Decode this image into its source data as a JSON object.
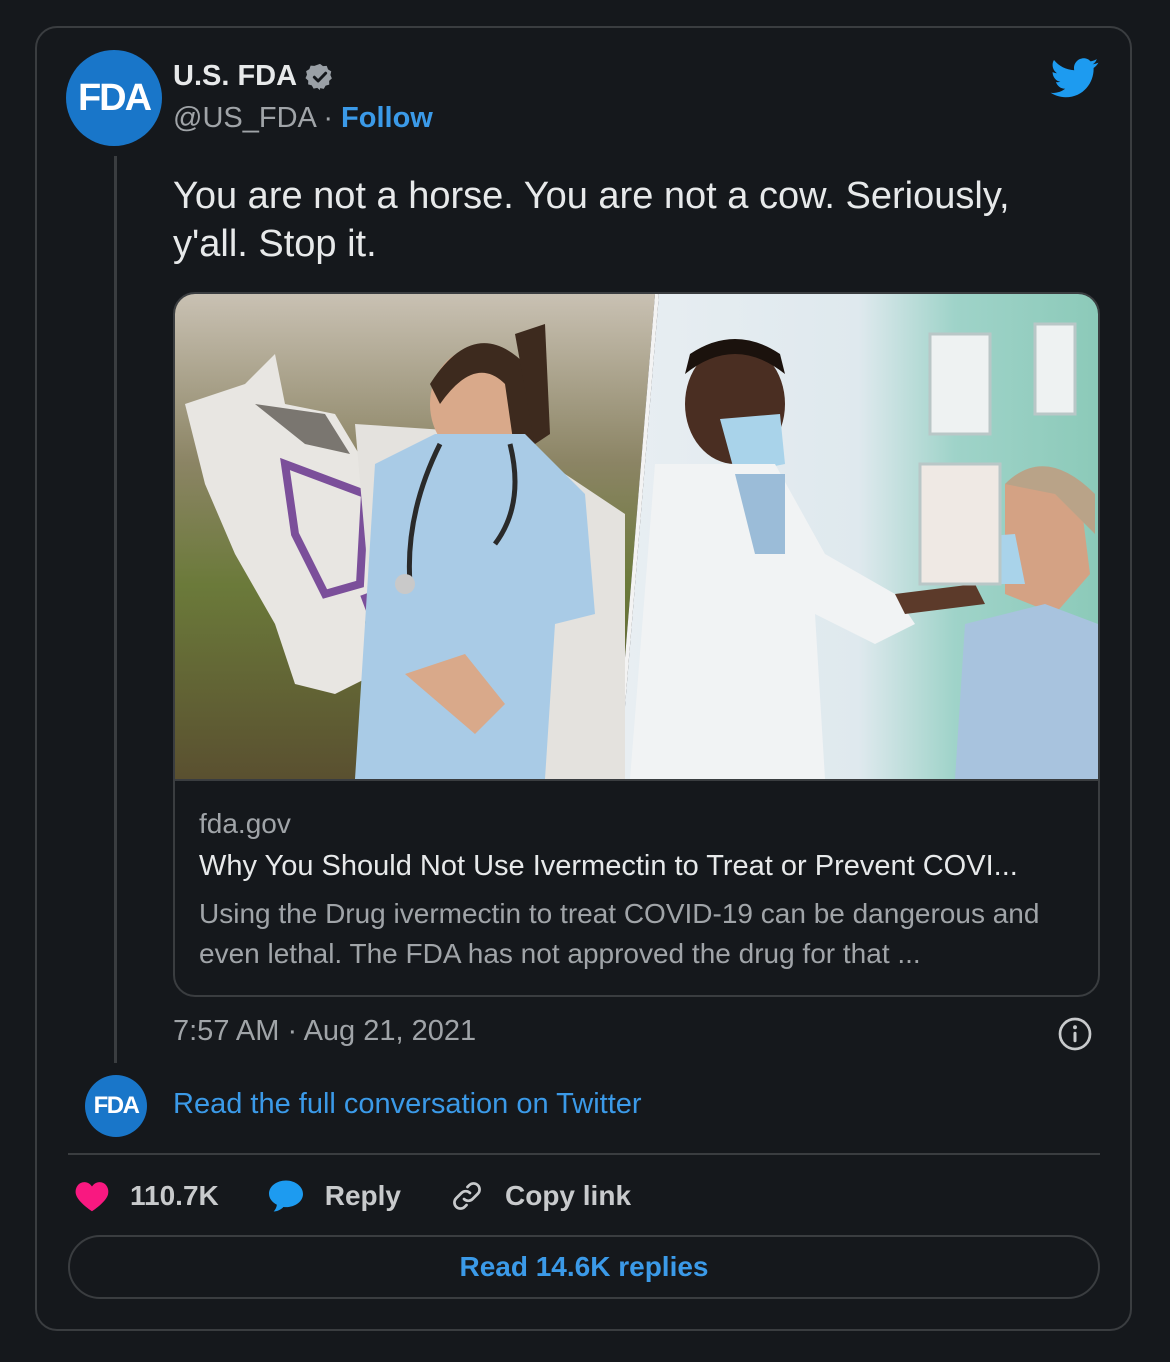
{
  "account": {
    "name": "U.S. FDA",
    "handle": "@US_FDA",
    "separator": " · ",
    "follow_label": "Follow",
    "avatar_text": "FDA"
  },
  "tweet": {
    "text": "You are not a horse. You are not a cow. Seriously, y'all. Stop it.",
    "timestamp": "7:57 AM · Aug 21, 2021"
  },
  "link_card": {
    "domain": "fda.gov",
    "title": "Why You Should Not Use Ivermectin to Treat or Prevent COVI...",
    "description": "Using the Drug ivermectin to treat COVID-19 can be dangerous and even lethal. The FDA has not approved the drug for that ..."
  },
  "conversation": {
    "avatar_text": "FDA",
    "label": "Read the full conversation on Twitter"
  },
  "actions": {
    "likes": "110.7K",
    "reply_label": "Reply",
    "copy_label": "Copy link"
  },
  "replies_button": "Read 14.6K replies",
  "colors": {
    "background": "#15181c",
    "accent": "#3b9ae8",
    "heart": "#f91880",
    "avatar": "#1976c9"
  }
}
